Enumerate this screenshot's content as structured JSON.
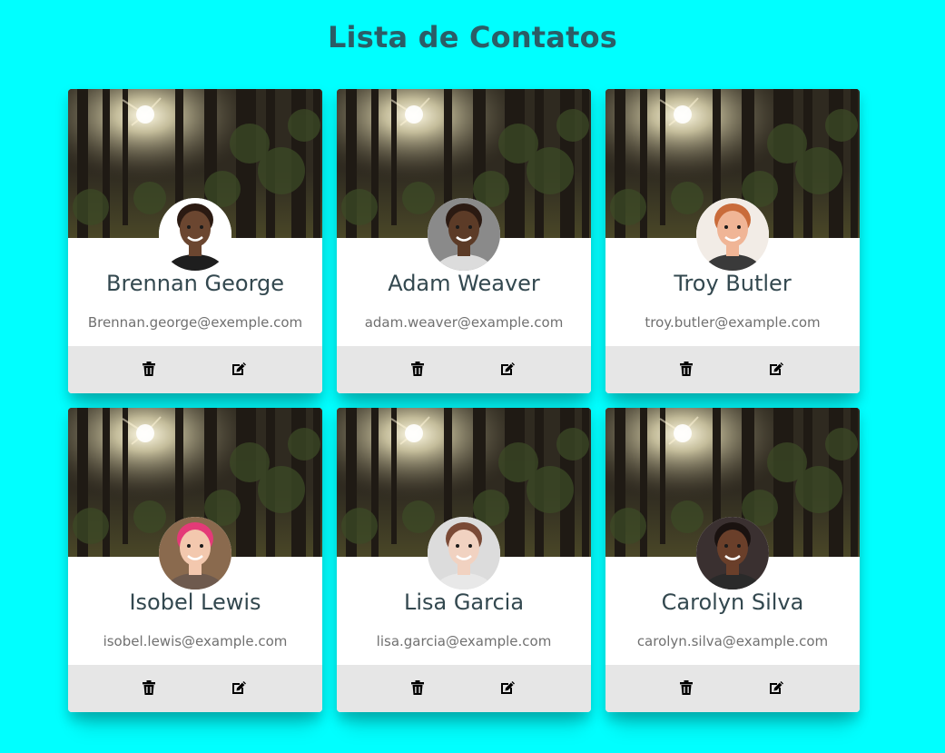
{
  "page": {
    "title": "Lista de Contatos",
    "background_color": "#00ffff",
    "title_color": "#2b5d66"
  },
  "contacts": [
    {
      "name": "Brennan George",
      "email": "Brennan.george@exemple.com",
      "avatar": {
        "skin": "#6b4630",
        "hair": "#2b1a12",
        "shirt": "#1e1e1e",
        "bg": "#ffffff"
      }
    },
    {
      "name": "Adam Weaver",
      "email": "adam.weaver@example.com",
      "avatar": {
        "skin": "#5c3b27",
        "hair": "#2b1a12",
        "shirt": "#dcdcdc",
        "bg": "#8a8a8a"
      }
    },
    {
      "name": "Troy Butler",
      "email": "troy.butler@example.com",
      "avatar": {
        "skin": "#f0b596",
        "hair": "#c96b3a",
        "shirt": "#3a3a3a",
        "bg": "#f2ece6"
      }
    },
    {
      "name": "Isobel Lewis",
      "email": "isobel.lewis@example.com",
      "avatar": {
        "skin": "#f3c8ae",
        "hair": "#e43a78",
        "shirt": "#6e5a4e",
        "bg": "#8a6a4e"
      }
    },
    {
      "name": "Lisa Garcia",
      "email": "lisa.garcia@example.com",
      "avatar": {
        "skin": "#f1d2c1",
        "hair": "#7a4a36",
        "shirt": "#e8e8e8",
        "bg": "#dcdcdc"
      }
    },
    {
      "name": "Carolyn Silva",
      "email": "carolyn.silva@example.com",
      "avatar": {
        "skin": "#6a3f2a",
        "hair": "#1a1210",
        "shirt": "#2a2a2a",
        "bg": "#3a3030"
      }
    }
  ],
  "actions": {
    "delete_icon": "trash-icon",
    "edit_icon": "edit-icon",
    "bar_color": "#e6e6e6"
  },
  "card": {
    "cover": "forest-photo",
    "background": "#ffffff"
  }
}
